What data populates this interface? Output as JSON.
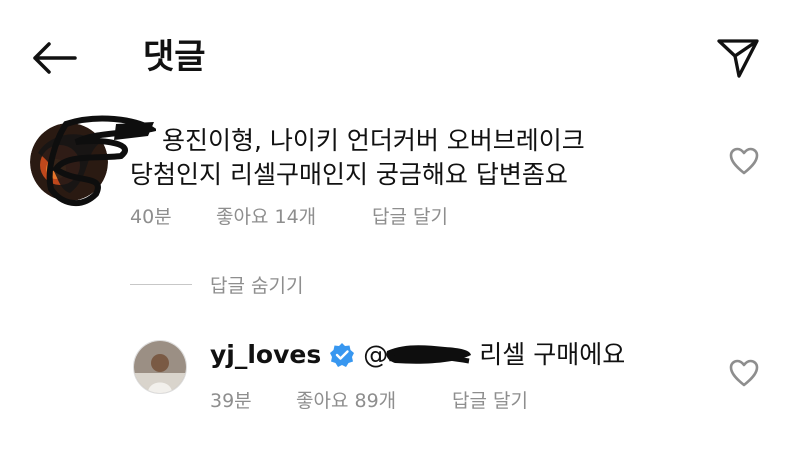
{
  "header": {
    "title": "댓글",
    "back_icon": "arrow-left-icon",
    "share_icon": "paper-plane-icon"
  },
  "comment": {
    "text_line1": "용진이형, 나이키 언더커버 오버브레이크",
    "text_line2": "당첨인지 리셀구매인지 궁금해요 답변좀요",
    "time": "40분",
    "likes": "좋아요 14개",
    "reply": "답글 달기"
  },
  "hide_replies": "답글 숨기기",
  "reply": {
    "username": "yj_loves",
    "mention_prefix": "@",
    "text": "리셀 구매에요",
    "time": "39분",
    "likes": "좋아요 89개",
    "reply": "답글 달기"
  },
  "colors": {
    "text": "#111111",
    "meta": "#8e8e8e",
    "verified": "#3897f0"
  }
}
